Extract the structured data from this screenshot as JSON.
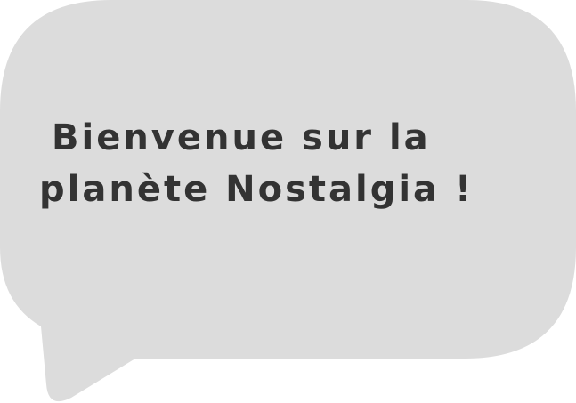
{
  "bubble": {
    "line_1": "Bienvenue sur la",
    "line_2": "planète Nostalgia !",
    "fill_color": "#dcdcdc",
    "text_color": "#333333"
  }
}
